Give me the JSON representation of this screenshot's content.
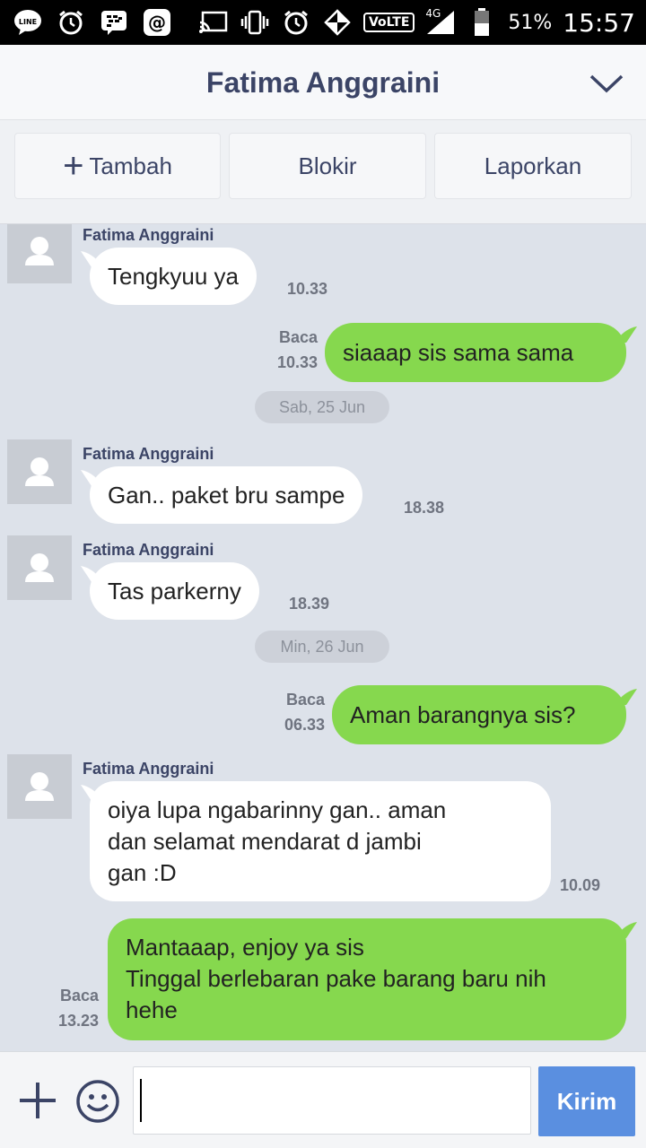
{
  "status_bar": {
    "battery": "51%",
    "time": "15:57",
    "network": "4G",
    "volte": "VoLTE",
    "icons_left": [
      "line-icon",
      "alarm-icon",
      "bbm-icon",
      "at-icon"
    ],
    "icons_right": [
      "cast-icon",
      "vibrate-icon",
      "alarm-icon",
      "data-icon",
      "volte-icon",
      "signal-icon",
      "battery-icon"
    ]
  },
  "header": {
    "title": "Fatima Anggraini"
  },
  "actions": {
    "add": "Tambah",
    "block": "Blokir",
    "report": "Laporkan"
  },
  "chat": {
    "messages": [
      {
        "sender": "Fatima Anggraini",
        "text": "Tengkyuu ya",
        "time": "10.33",
        "direction": "in"
      },
      {
        "read": "Baca",
        "text": "siaaap sis sama sama",
        "time": "10.33",
        "direction": "out"
      },
      {
        "date": "Sab, 25 Jun"
      },
      {
        "sender": "Fatima Anggraini",
        "text": "Gan.. paket bru sampe",
        "time": "18.38",
        "direction": "in"
      },
      {
        "sender": "Fatima Anggraini",
        "text": "Tas parkerny",
        "time": "18.39",
        "direction": "in"
      },
      {
        "date": "Min, 26 Jun"
      },
      {
        "read": "Baca",
        "text": "Aman barangnya sis?",
        "time": "06.33",
        "direction": "out"
      },
      {
        "sender": "Fatima Anggraini",
        "text": "oiya lupa ngabarinny gan.. aman\ndan selamat mendarat d jambi\ngan :D",
        "time": "10.09",
        "direction": "in"
      },
      {
        "read": "Baca",
        "text": "Mantaaap, enjoy ya sis\nTinggal berlebaran pake barang baru nih\nhehe",
        "time": "13.23",
        "direction": "out"
      }
    ]
  },
  "input": {
    "value": "",
    "send_label": "Kirim"
  },
  "colors": {
    "outgoing_bubble": "#86d84e",
    "incoming_bubble": "#ffffff",
    "chat_background": "#dde2ea",
    "send_button": "#5a8fe0",
    "header_text": "#3b4466"
  }
}
